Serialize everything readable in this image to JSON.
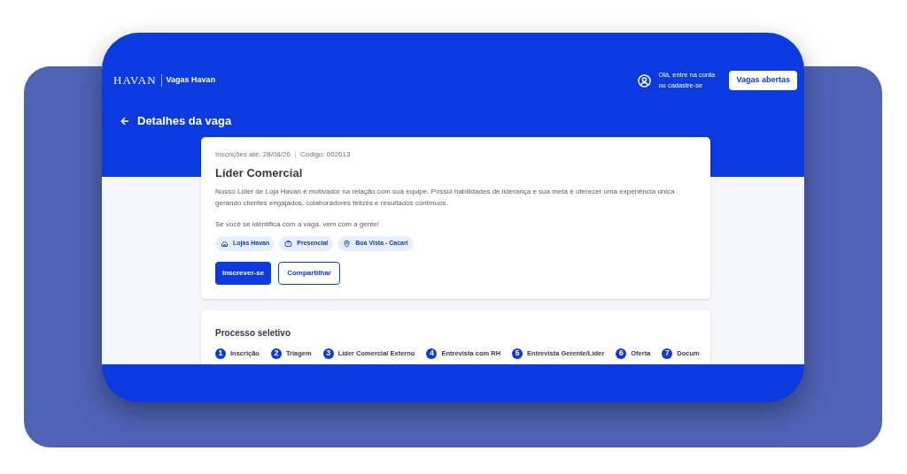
{
  "header": {
    "logo": "HAVAN",
    "site_name": "Vagas Havan",
    "account_text": "Olá, entre na conta ou cadastre-se",
    "open_jobs_button": "Vagas abertas"
  },
  "page_title": "Detalhes da vaga",
  "job": {
    "deadline": "Inscrições até: 28/08/26",
    "code": "Código: 002613",
    "title": "Líder Comercial",
    "description": "Nosso Líder de Loja Havan é motivador na relação com sua equipe. Possui habilidades de liderança e sua meta é oferecer uma experiência única gerando clientes engajados, colaboradores felizes e resultados contínuos.",
    "tagline": "Se você se identifica com a vaga, vem com a gente!",
    "tags": [
      {
        "kind": "store",
        "label": "Lojas Havan"
      },
      {
        "kind": "workplace",
        "label": "Presencial"
      },
      {
        "kind": "location",
        "label": "Boa Vista - Cacari"
      }
    ],
    "apply_button": "Inscrever-se",
    "share_button": "Compartilhar"
  },
  "process": {
    "title": "Processo seletivo",
    "steps": [
      {
        "number": "1",
        "label": "Inscrição"
      },
      {
        "number": "2",
        "label": "Triagem"
      },
      {
        "number": "3",
        "label": "Líder Comercial Externo"
      },
      {
        "number": "4",
        "label": "Entrevista com RH"
      },
      {
        "number": "5",
        "label": "Entrevista Gerente/Líder"
      },
      {
        "number": "6",
        "label": "Oferta"
      },
      {
        "number": "7",
        "label": "Docum"
      }
    ]
  }
}
